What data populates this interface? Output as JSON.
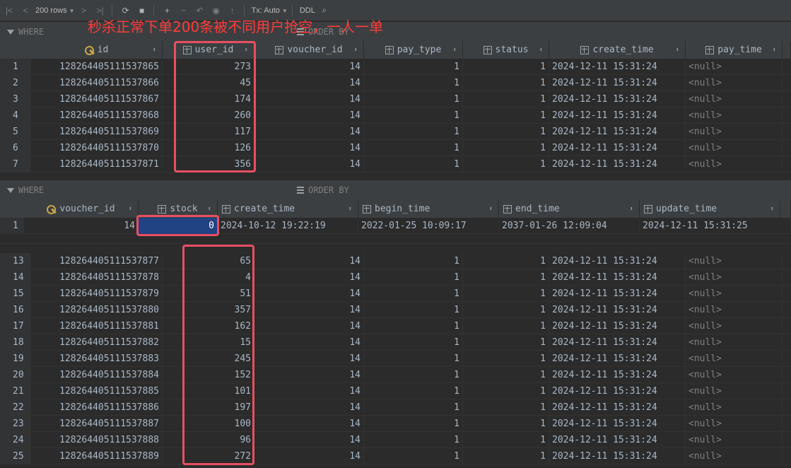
{
  "toolbar": {
    "rows_label": "200 rows",
    "tx_label": "Tx: Auto",
    "ddl_label": "DDL"
  },
  "filter_top": {
    "where": "WHERE",
    "order_by": "ORDER BY"
  },
  "filter_mid": {
    "where": "WHERE",
    "order_by": "ORDER BY"
  },
  "annotation": "秒杀正常下单200条被不同用户抢空，一人一单",
  "orders": {
    "columns": [
      "id",
      "user_id",
      "voucher_id",
      "pay_type",
      "status",
      "create_time",
      "pay_time"
    ],
    "rows_top": [
      [
        "1",
        "128264405111537865",
        "273",
        "14",
        "1",
        "1",
        "2024-12-11 15:31:24",
        "<null>"
      ],
      [
        "2",
        "128264405111537866",
        "45",
        "14",
        "1",
        "1",
        "2024-12-11 15:31:24",
        "<null>"
      ],
      [
        "3",
        "128264405111537867",
        "174",
        "14",
        "1",
        "1",
        "2024-12-11 15:31:24",
        "<null>"
      ],
      [
        "4",
        "128264405111537868",
        "260",
        "14",
        "1",
        "1",
        "2024-12-11 15:31:24",
        "<null>"
      ],
      [
        "5",
        "128264405111537869",
        "117",
        "14",
        "1",
        "1",
        "2024-12-11 15:31:24",
        "<null>"
      ],
      [
        "6",
        "128264405111537870",
        "126",
        "14",
        "1",
        "1",
        "2024-12-11 15:31:24",
        "<null>"
      ],
      [
        "7",
        "128264405111537871",
        "356",
        "14",
        "1",
        "1",
        "2024-12-11 15:31:24",
        "<null>"
      ]
    ],
    "rows_bottom": [
      [
        "13",
        "128264405111537877",
        "65",
        "14",
        "1",
        "1",
        "2024-12-11 15:31:24",
        "<null>"
      ],
      [
        "14",
        "128264405111537878",
        "4",
        "14",
        "1",
        "1",
        "2024-12-11 15:31:24",
        "<null>"
      ],
      [
        "15",
        "128264405111537879",
        "51",
        "14",
        "1",
        "1",
        "2024-12-11 15:31:24",
        "<null>"
      ],
      [
        "16",
        "128264405111537880",
        "357",
        "14",
        "1",
        "1",
        "2024-12-11 15:31:24",
        "<null>"
      ],
      [
        "17",
        "128264405111537881",
        "162",
        "14",
        "1",
        "1",
        "2024-12-11 15:31:24",
        "<null>"
      ],
      [
        "18",
        "128264405111537882",
        "15",
        "14",
        "1",
        "1",
        "2024-12-11 15:31:24",
        "<null>"
      ],
      [
        "19",
        "128264405111537883",
        "245",
        "14",
        "1",
        "1",
        "2024-12-11 15:31:24",
        "<null>"
      ],
      [
        "20",
        "128264405111537884",
        "152",
        "14",
        "1",
        "1",
        "2024-12-11 15:31:24",
        "<null>"
      ],
      [
        "21",
        "128264405111537885",
        "101",
        "14",
        "1",
        "1",
        "2024-12-11 15:31:24",
        "<null>"
      ],
      [
        "22",
        "128264405111537886",
        "197",
        "14",
        "1",
        "1",
        "2024-12-11 15:31:24",
        "<null>"
      ],
      [
        "23",
        "128264405111537887",
        "100",
        "14",
        "1",
        "1",
        "2024-12-11 15:31:24",
        "<null>"
      ],
      [
        "24",
        "128264405111537888",
        "96",
        "14",
        "1",
        "1",
        "2024-12-11 15:31:24",
        "<null>"
      ],
      [
        "25",
        "128264405111537889",
        "272",
        "14",
        "1",
        "1",
        "2024-12-11 15:31:24",
        "<null>"
      ]
    ]
  },
  "stock": {
    "columns": [
      "voucher_id",
      "stock",
      "create_time",
      "begin_time",
      "end_time",
      "update_time"
    ],
    "rows": [
      [
        "1",
        "14",
        "0",
        "2024-10-12 19:22:19",
        "2022-01-25 10:09:17",
        "2037-01-26 12:09:04",
        "2024-12-11 15:31:25"
      ]
    ]
  },
  "colors": {
    "highlight": "#e84f62",
    "selection": "#214283",
    "annotation": "#ff3b3b"
  }
}
